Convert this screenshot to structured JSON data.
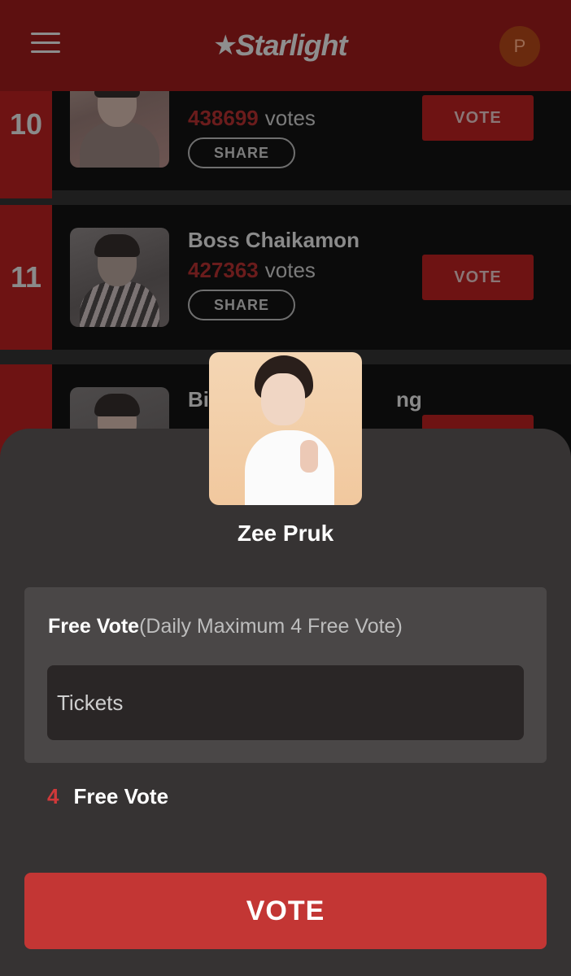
{
  "header": {
    "logo_text": "Starlight",
    "avatar_letter": "P",
    "menu_icon": "hamburger-menu-icon"
  },
  "ranking": [
    {
      "rank": "10",
      "name": "",
      "votes": "438699",
      "votes_unit": "votes",
      "share_label": "SHARE",
      "vote_label": "VOTE"
    },
    {
      "rank": "11",
      "name": "Boss Chaikamon",
      "votes": "427363",
      "votes_unit": "votes",
      "share_label": "SHARE",
      "vote_label": "VOTE"
    },
    {
      "rank": "",
      "name": "Bi",
      "name_tail": "ng",
      "votes": "",
      "votes_unit": "",
      "share_label": "",
      "vote_label": ""
    }
  ],
  "vote_sheet": {
    "candidate_name": "Zee Pruk",
    "free_vote_label": "Free Vote",
    "free_vote_note": "(Daily Maximum 4 Free Vote)",
    "tickets_placeholder": "Tickets",
    "free_vote_count": "4",
    "free_vote_count_label": "Free Vote",
    "vote_button_label": "VOTE"
  },
  "colors": {
    "accent_red": "#c33634",
    "sheet_bg": "#363333",
    "panel_bg": "#4a4747"
  }
}
